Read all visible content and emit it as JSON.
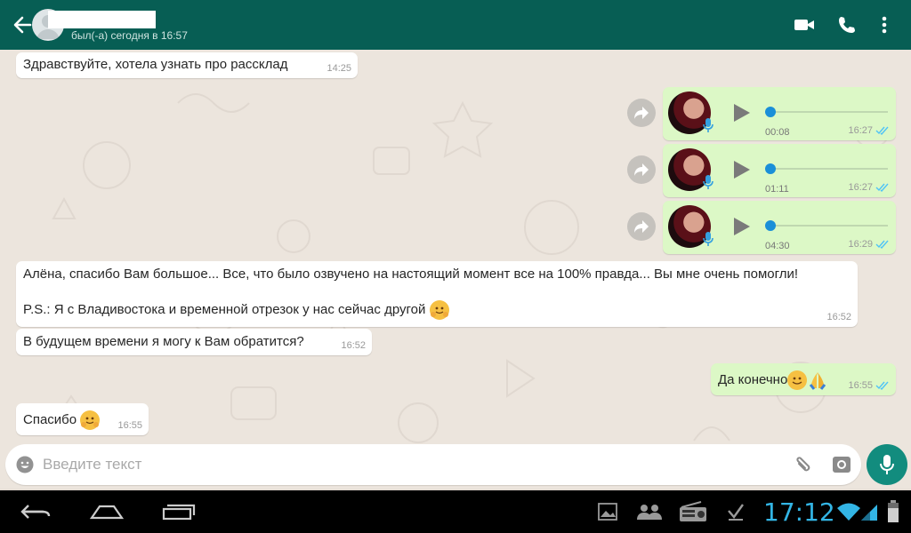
{
  "header": {
    "status": "был(-а) сегодня в 16:57",
    "bg_color": "#075e54"
  },
  "messages": [
    {
      "dir": "in",
      "text": "Здравствуйте, хотела узнать про расcклад",
      "time": "14:25"
    },
    {
      "dir": "out",
      "type": "voice",
      "duration": "00:08",
      "time": "16:27",
      "ticks": "read"
    },
    {
      "dir": "out",
      "type": "voice",
      "duration": "01:11",
      "time": "16:27",
      "ticks": "read"
    },
    {
      "dir": "out",
      "type": "voice",
      "duration": "04:30",
      "time": "16:29",
      "ticks": "read"
    },
    {
      "dir": "in",
      "line1": "Алёна, спасибо Вам большое... Все, что было озвучено на настоящий момент  все на 100% правда... Вы мне очень помогли!",
      "line2": "P.S.: Я с Владивостока и временной отрезок у нас сейчас другой",
      "emoji": "hugging-face",
      "time": "16:52"
    },
    {
      "dir": "in",
      "text": "В будущем времени я могу к Вам обратится?",
      "time": "16:52"
    },
    {
      "dir": "out",
      "text": "Да конечно",
      "emoji": [
        "smiling-face",
        "folded-hands"
      ],
      "time": "16:55",
      "ticks": "read"
    },
    {
      "dir": "in",
      "text": "Спасибо",
      "emoji": "hugging-face",
      "time": "16:55"
    }
  ],
  "input": {
    "placeholder": "Введите текст"
  },
  "system_bar": {
    "time": "17:12",
    "accent_color": "#33b5e5"
  },
  "icons": [
    "back-arrow-icon",
    "video-call-icon",
    "phone-icon",
    "more-icon",
    "forward-icon",
    "play-icon",
    "mic-icon",
    "emoji-icon",
    "attach-icon",
    "camera-icon",
    "home-icon",
    "recents-icon",
    "gallery-icon",
    "contacts-icon",
    "radio-icon",
    "download-icon",
    "wifi-icon",
    "signal-icon",
    "battery-icon"
  ]
}
